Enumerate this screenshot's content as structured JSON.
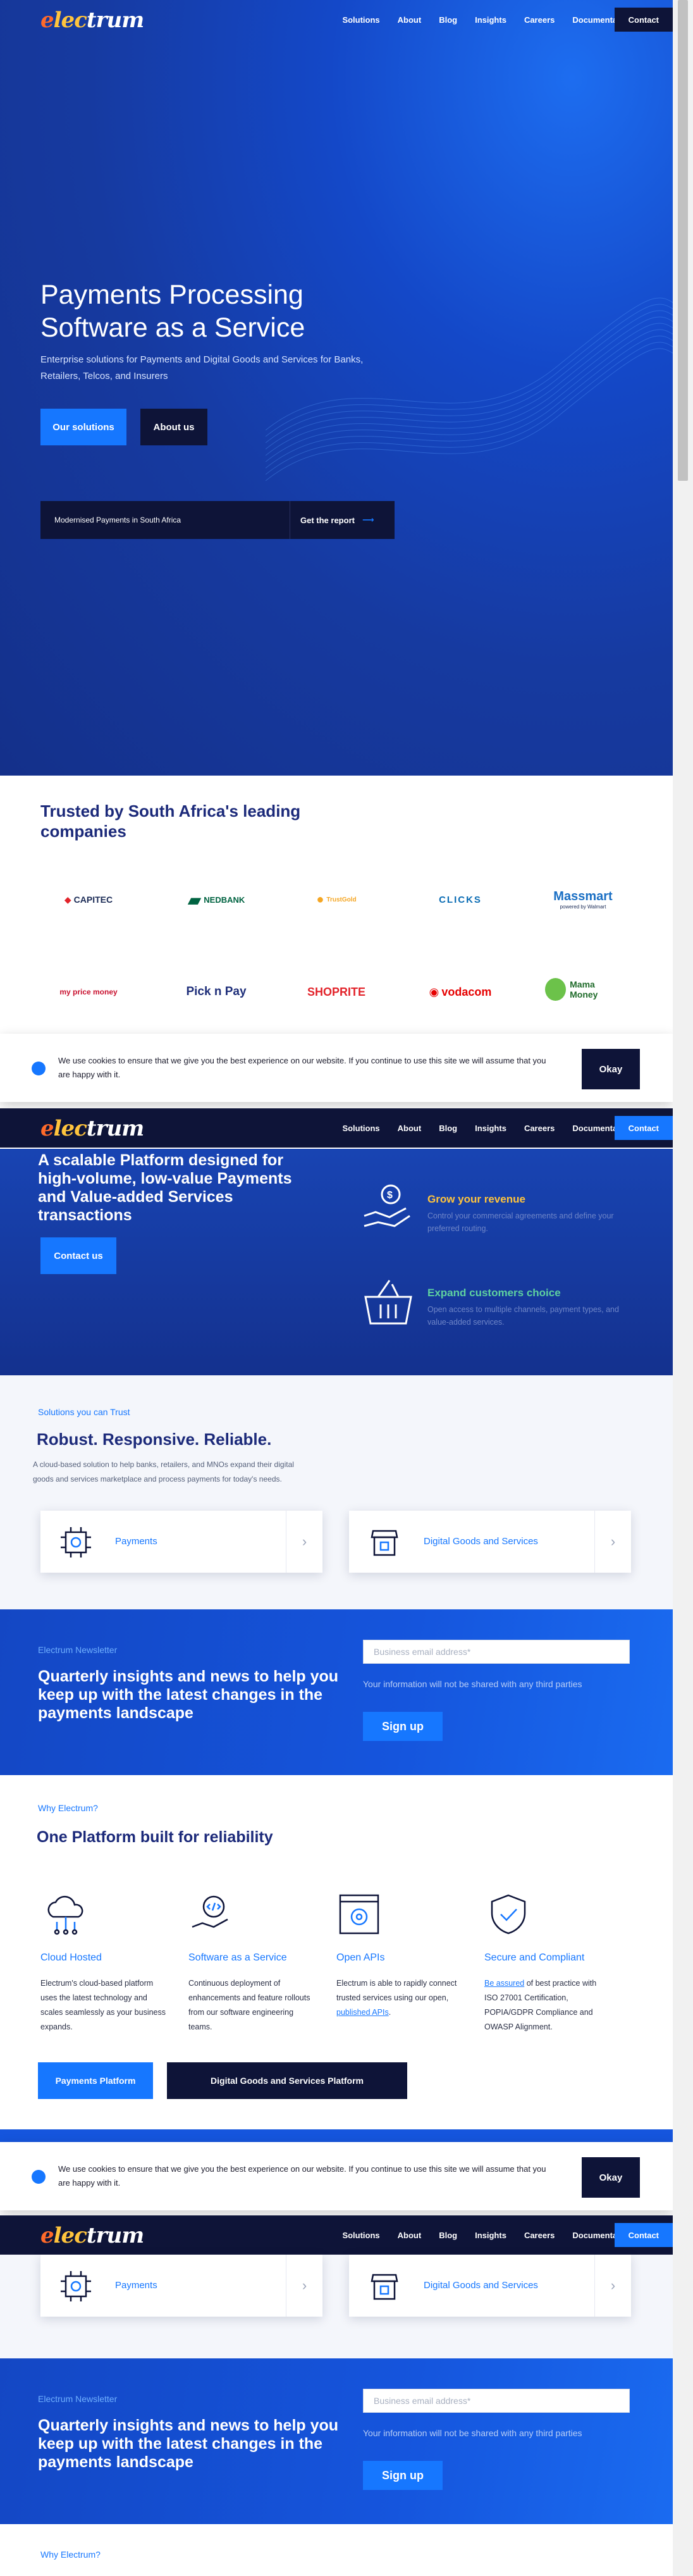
{
  "brand": {
    "logo_text": "electrum",
    "logo_e": "e",
    "logo_c": "lec",
    "logo_rest": "trum",
    "accent": "#1677ff",
    "navy": "#0e1438"
  },
  "nav": {
    "items": [
      "Solutions",
      "About",
      "Blog",
      "Insights",
      "Careers",
      "Documentation"
    ],
    "contact": "Contact"
  },
  "hero": {
    "title_line1": "Payments Processing",
    "title_line2": "Software as a Service",
    "subtitle": "Enterprise solutions for Payments and Digital Goods and Services for Banks, Retailers, Telcos, and Insurers",
    "btn_solutions": "Our solutions",
    "btn_about": "About us",
    "report_text": "Modernised Payments in South Africa",
    "report_link": "Get the report",
    "report_arrow": "⟶"
  },
  "trusted": {
    "title_line1": "Trusted by South Africa's leading",
    "title_line2": "companies",
    "logos_row1": [
      "CAPITEC",
      "NEDBANK",
      "TrustGold",
      "CLICKS",
      "Massmart"
    ],
    "massmart_sub": "powered by Walmart",
    "logos_row2": [
      "my price money",
      "Pick n Pay",
      "SHOPRITE",
      "vodacom",
      "Mama Money"
    ]
  },
  "cookie": {
    "text": "We use cookies to ensure that we give you the best experience on our website. If you continue to use this site we will assume that you are happy with it.",
    "ok": "Okay"
  },
  "platform": {
    "title": "A scalable Platform designed for high-volume, low-value Payments and Value-added Services transactions",
    "contact_btn": "Contact us",
    "grow_title": "Grow your revenue",
    "grow_text": "Control your commercial agreements and define your preferred routing.",
    "expand_title": "Expand customers choice",
    "expand_text": "Open access to multiple channels, payment types, and value-added services."
  },
  "solutions": {
    "kicker": "Solutions you can Trust",
    "title": "Robust. Responsive. Reliable.",
    "text": "A cloud-based solution to help banks, retailers, and MNOs expand their digital goods and services marketplace and process payments for today's needs.",
    "card1": "Payments",
    "card2": "Digital Goods and Services",
    "chevron": "›"
  },
  "newsletter": {
    "kicker": "Electrum Newsletter",
    "title": "Quarterly insights and news to help you keep up with the latest changes in the payments landscape",
    "placeholder": "Business email address*",
    "note": "Your information will not be shared with any third parties",
    "btn": "Sign up"
  },
  "why": {
    "kicker": "Why Electrum?",
    "title": "One Platform built for reliability",
    "f1_title": "Cloud Hosted",
    "f1_text": "Electrum's cloud-based platform uses the latest technology and scales seamlessly as your business expands.",
    "f2_title": "Software as a Service",
    "f2_text": "Continuous deployment of enhancements and feature rollouts from our software engineering teams.",
    "f3_title": "Open APIs",
    "f3_text_a": "Electrum is able to rapidly connect trusted services using our open, ",
    "f3_link": "published APIs",
    "f3_text_b": ".",
    "f4_title": "Secure and Compliant",
    "f4_link": "Be assured",
    "f4_text": " of best practice with ISO 27001 Certification, POPIA/GDPR Compliance and OWASP Alignment.",
    "btn_payments": "Payments Platform",
    "btn_dgs": "Digital Goods and Services Platform"
  }
}
